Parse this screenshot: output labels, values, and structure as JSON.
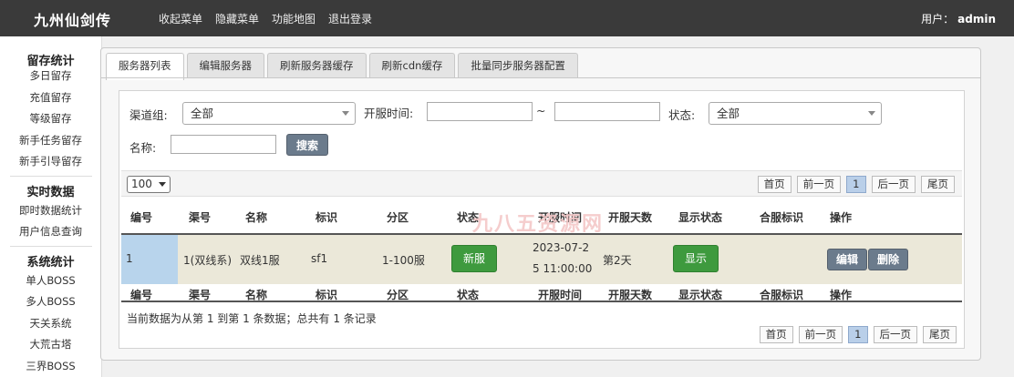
{
  "header": {
    "logo": "九州仙剑传",
    "nav": [
      "收起菜单",
      "隐藏菜单",
      "功能地图",
      "退出登录"
    ],
    "user_label": "用户：",
    "username": "admin"
  },
  "sidebar": {
    "groups": [
      {
        "title": "留存统计",
        "items": [
          "多日留存",
          "充值留存",
          "等级留存",
          "新手任务留存",
          "新手引导留存"
        ]
      },
      {
        "title": "实时数据",
        "items": [
          "即时数据统计",
          "用户信息查询"
        ]
      },
      {
        "title": "系统统计",
        "items": [
          "单人BOSS",
          "多人BOSS",
          "天关系统",
          "大荒古塔",
          "三界BOSS"
        ]
      }
    ]
  },
  "tabs": [
    "服务器列表",
    "编辑服务器",
    "刷新服务器缓存",
    "刷新cdn缓存",
    "批量同步服务器配置"
  ],
  "active_tab": 0,
  "filters": {
    "channel_label": "渠道组:",
    "channel_value": "全部",
    "open_time_label": "开服时间:",
    "range_sep": "~",
    "start_value": "",
    "end_value": "",
    "status_label": "状态:",
    "status_value": "全部",
    "name_label": "名称:",
    "name_value": "",
    "search_label": "搜索"
  },
  "pagination": {
    "page_size": "100",
    "first": "首页",
    "prev": "前一页",
    "current": "1",
    "next": "后一页",
    "last": "尾页"
  },
  "table": {
    "columns": [
      "编号",
      "渠号",
      "名称",
      "标识",
      "分区",
      "状态",
      "开服时间",
      "开服天数",
      "显示状态",
      "合服标识",
      "操作"
    ],
    "rows": [
      {
        "id": "1",
        "channel": "1(双线系)",
        "name": "双线1服",
        "tag": "sf1",
        "zone": "1-100服",
        "status": "新服",
        "open_time_line1": "2023-07-2",
        "open_time_line2": "5 11:00:00",
        "open_days": "第2天",
        "display": "显示",
        "merge_tag": "",
        "edit": "编辑",
        "delete": "删除"
      }
    ],
    "summary": "当前数据为从第 1 到第 1 条数据；总共有 1 条记录"
  },
  "watermark": "九八五资源网"
}
